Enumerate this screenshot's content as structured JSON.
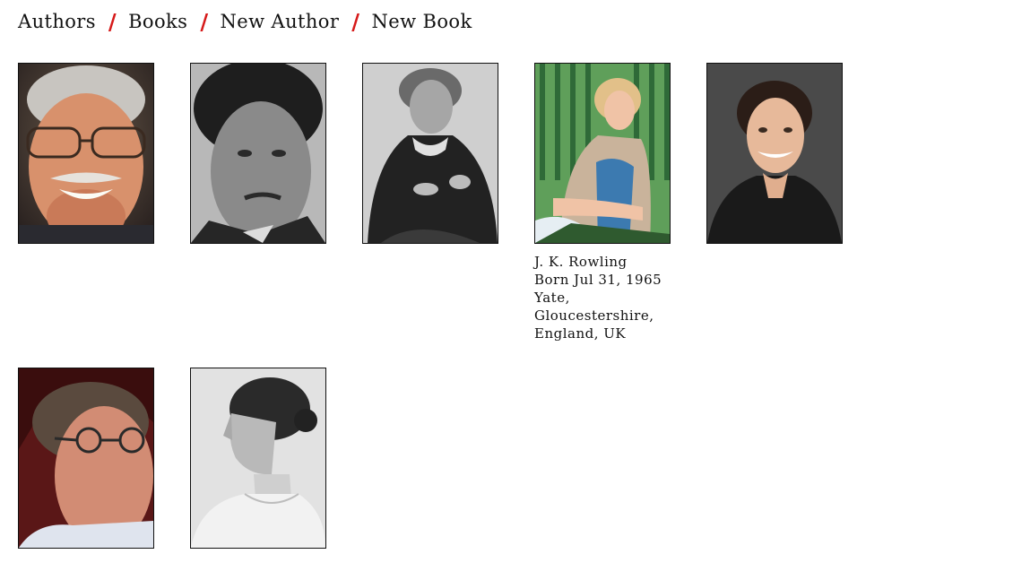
{
  "nav": {
    "items": [
      "Authors",
      "Books",
      "New Author",
      "New Book"
    ],
    "separator": "/",
    "separator_color": "#d61a1a"
  },
  "authors": [
    {
      "icon": "author-portrait-icon"
    },
    {
      "icon": "author-portrait-icon"
    },
    {
      "icon": "author-portrait-icon"
    },
    {
      "icon": "author-portrait-icon",
      "name": "J. K. Rowling",
      "born": "Born Jul 31, 1965",
      "birthplace": "Yate, Gloucestershire, England, UK"
    },
    {
      "icon": "author-portrait-icon"
    },
    {
      "icon": "author-portrait-icon"
    },
    {
      "icon": "author-portrait-icon"
    }
  ]
}
